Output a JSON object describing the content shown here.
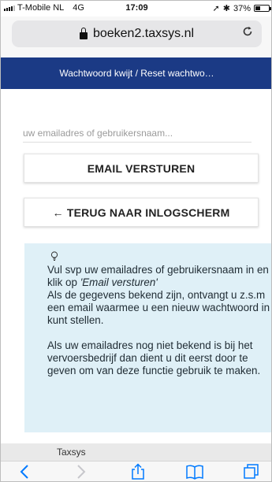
{
  "status_bar": {
    "carrier": "T-Mobile NL",
    "network": "4G",
    "time": "17:09",
    "battery": "37%",
    "battery_level": 0.37
  },
  "browser": {
    "url": "boeken2.taxsys.nl",
    "reload_icon": "reload-icon",
    "lock_icon": "lock-icon"
  },
  "header": {
    "title": "Wachtwoord kwijt / Reset wachtwo…",
    "color": "#1b3a85"
  },
  "form": {
    "email_placeholder": "uw emailadres of gebruikersnaam...",
    "email_value": "",
    "send_label": "EMAIL VERSTUREN",
    "back_label": "← TERUG NAAR INLOGSCHERM"
  },
  "info": {
    "icon": "lightbulb-icon",
    "background": "#dff0f7",
    "p1_before": "Vul svp uw emailadres of gebruikersnaam in en klik op ",
    "p1_quote": "'Email versturen'",
    "p1_after": "Als de gegevens bekend zijn, ontvangt u z.s.m een email waarmee u een nieuw wachtwoord in kunt stellen.",
    "p2": "Als uw emailadres nog niet bekend is bij het vervoersbedrijf dan dient u dit eerst door te geven om van deze functie gebruik te maken."
  },
  "footer": {
    "text": "Taxsys"
  },
  "toolbar": {
    "back": "back-icon",
    "forward": "forward-icon",
    "share": "share-icon",
    "bookmarks": "bookmarks-icon",
    "tabs": "tabs-icon",
    "accent": "#007aff"
  }
}
